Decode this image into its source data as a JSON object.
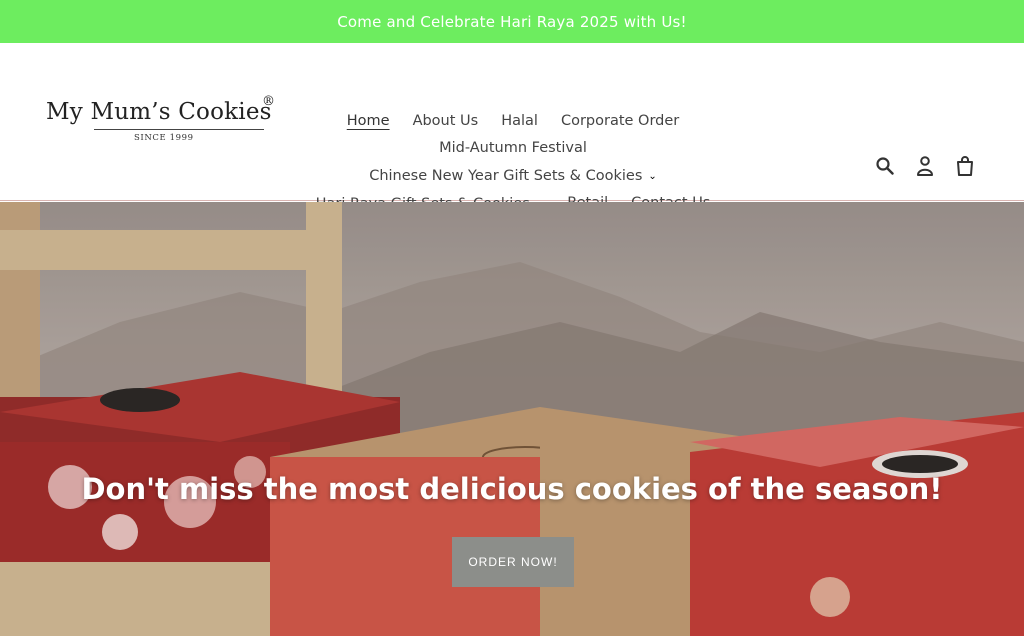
{
  "announcement": {
    "text": "Come and Celebrate Hari Raya 2025 with Us!"
  },
  "logo": {
    "name": "My Mum’s Cookies",
    "registered": "®",
    "tagline": "SINCE 1999"
  },
  "nav": {
    "row1": [
      "Home",
      "About Us",
      "Halal",
      "Corporate Order"
    ],
    "row2": [
      "Mid-Autumn Festival"
    ],
    "row3": [
      "Chinese New Year Gift Sets & Cookies"
    ],
    "row4": [
      "Hari Raya Gift Sets & Cookies",
      "Retail",
      "Contact Us"
    ]
  },
  "icons": [
    "search-icon",
    "account-icon",
    "cart-icon"
  ],
  "hero": {
    "headline": "Don't miss the most delicious cookies of the season!",
    "cta_label": "ORDER NOW!"
  },
  "colors": {
    "announcement_bg": "#6ded5f",
    "cta_bg": "#8c8e8a",
    "box_red": "#c9403a",
    "kraft": "#c7a077"
  }
}
